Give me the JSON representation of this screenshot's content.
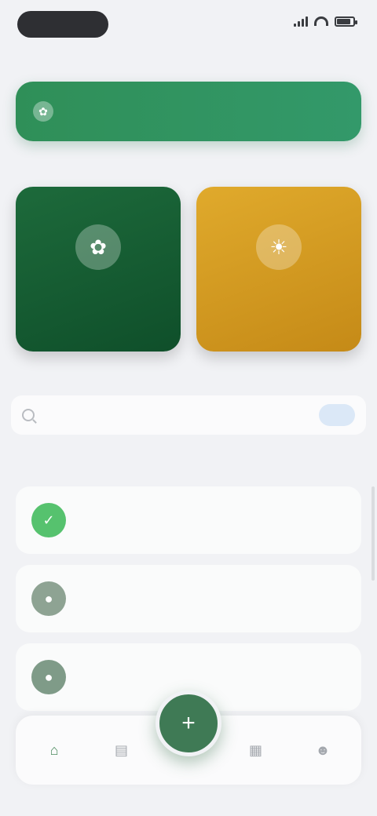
{
  "status": {
    "time": "",
    "battery_level": 0.85
  },
  "banner": {
    "icon": "leaf-icon",
    "text": ""
  },
  "quick_section": {
    "title": ""
  },
  "cards": [
    {
      "label": "",
      "icon": "plant-icon",
      "color": "#1d6a3b"
    },
    {
      "label": "",
      "icon": "sun-icon",
      "color": "#d39a22"
    }
  ],
  "search_section": {
    "title": ""
  },
  "search": {
    "placeholder": "",
    "button_label": ""
  },
  "list_section": {
    "title": ""
  },
  "list": [
    {
      "title": "",
      "subtitle": "",
      "icon": "check-icon",
      "color": "#56c26e"
    },
    {
      "title": "",
      "subtitle": "",
      "icon": "circle-icon",
      "color": "#8ea393"
    },
    {
      "title": "",
      "subtitle": "",
      "icon": "circle-icon",
      "color": "#7f9b88"
    }
  ],
  "nav": {
    "items": [
      {
        "icon": "home-icon"
      },
      {
        "icon": "chart-icon"
      },
      {
        "icon": "add-icon"
      },
      {
        "icon": "calendar-icon"
      },
      {
        "icon": "profile-icon"
      }
    ]
  },
  "colors": {
    "accent": "#33996a",
    "gold": "#d39a22",
    "dark_green": "#0f4f2a"
  }
}
